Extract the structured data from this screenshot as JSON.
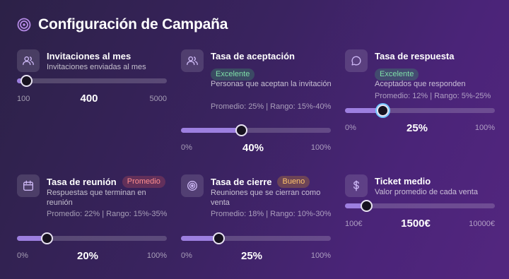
{
  "header": {
    "title": "Configuración de Campaña",
    "icon": "target-icon"
  },
  "colors": {
    "accent": "#9d7fe0",
    "focus_ring": "#73c6ff"
  },
  "cards": {
    "invitaciones": {
      "icon": "users-icon",
      "label": "Invitaciones al mes",
      "description": "Invitaciones enviadas al mes",
      "min": "100",
      "max": "5000",
      "current": "400",
      "slider_value": 400,
      "slider_min": 100,
      "slider_max": 5000
    },
    "aceptacion": {
      "icon": "users-icon",
      "label": "Tasa de aceptación",
      "badge": "Excelente",
      "description": "Personas que aceptan la invitación",
      "stats": "Promedio: 25% | Rango: 15%-40%",
      "min": "0%",
      "max": "100%",
      "current": "40%",
      "slider_value": 40,
      "slider_min": 0,
      "slider_max": 100
    },
    "respuesta": {
      "icon": "chat-bubble-icon",
      "label": "Tasa de respuesta",
      "badge": "Excelente",
      "description": "Aceptados que responden",
      "stats": "Promedio: 12% | Rango: 5%-25%",
      "min": "0%",
      "max": "100%",
      "current": "25%",
      "slider_value": 25,
      "slider_min": 0,
      "slider_max": 100
    },
    "reunion": {
      "icon": "calendar-icon",
      "label": "Tasa de reunión",
      "badge": "Promedio",
      "description": "Respuestas que terminan en reunión",
      "stats": "Promedio: 22% | Rango: 15%-35%",
      "min": "0%",
      "max": "100%",
      "current": "20%",
      "slider_value": 20,
      "slider_min": 0,
      "slider_max": 100
    },
    "cierre": {
      "icon": "target-icon",
      "label": "Tasa de cierre",
      "badge": "Bueno",
      "description": "Reuniones que se cierran como venta",
      "stats": "Promedio: 18% | Rango: 10%-30%",
      "min": "0%",
      "max": "100%",
      "current": "25%",
      "slider_value": 25,
      "slider_min": 0,
      "slider_max": 100
    },
    "ticket": {
      "icon": "dollar-icon",
      "label": "Ticket medio",
      "description": "Valor promedio de cada venta",
      "min": "100€",
      "max": "10000€",
      "current": "1500€",
      "slider_value": 1500,
      "slider_min": 100,
      "slider_max": 10000
    }
  }
}
